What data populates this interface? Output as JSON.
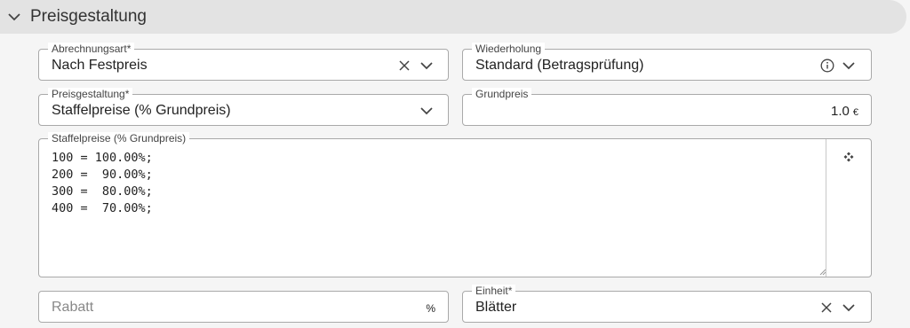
{
  "panel": {
    "title": "Preisgestaltung"
  },
  "billing_type": {
    "label": "Abrechnungsart*",
    "value": "Nach Festpreis"
  },
  "repetition": {
    "label": "Wiederholung",
    "value": "Standard (Betragsprüfung)"
  },
  "pricing": {
    "label": "Preisgestaltung*",
    "value": "Staffelpreise (% Grundpreis)"
  },
  "base_price": {
    "label": "Grundpreis",
    "value": "1.0",
    "unit": "€"
  },
  "tiers": {
    "label": "Staffelpreise (% Grundpreis)",
    "lines": [
      "100 = 100.00%;",
      "200 =  90.00%;",
      "300 =  80.00%;",
      "400 =  70.00%;"
    ]
  },
  "discount": {
    "placeholder": "Rabatt",
    "unit": "%"
  },
  "unit_field": {
    "label": "Einheit*",
    "value": "Blätter"
  },
  "icons": {
    "header": "chevron-down-icon",
    "clear": "close-icon",
    "dropdown": "chevron-down-icon",
    "info": "info-icon",
    "expand": "four-diamonds-icon"
  }
}
